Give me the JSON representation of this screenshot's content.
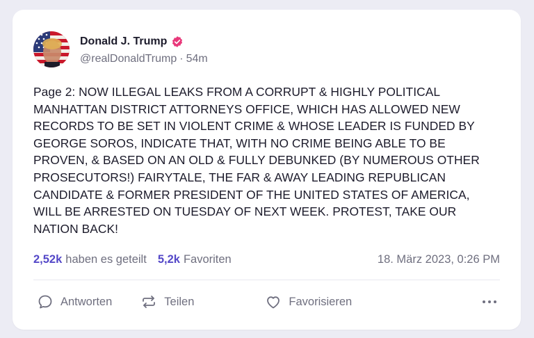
{
  "post": {
    "author": {
      "display_name": "Donald J. Trump",
      "handle": "@realDonaldTrump",
      "separator": "·",
      "age": "54m",
      "verified_icon": "verified-badge-icon",
      "verified_color": "#e8387a"
    },
    "text": "Page 2: NOW ILLEGAL LEAKS FROM A CORRUPT & HIGHLY POLITICAL MANHATTAN DISTRICT ATTORNEYS OFFICE, WHICH HAS ALLOWED NEW RECORDS TO BE SET IN VIOLENT CRIME & WHOSE LEADER IS FUNDED BY GEORGE SOROS, INDICATE THAT, WITH NO CRIME BEING ABLE TO BE PROVEN, & BASED ON AN OLD & FULLY DEBUNKED (BY NUMEROUS OTHER PROSECUTORS!) FAIRYTALE, THE FAR & AWAY LEADING REPUBLICAN CANDIDATE & FORMER PRESIDENT OF THE UNITED STATES OF AMERICA, WILL BE ARRESTED ON TUESDAY OF NEXT WEEK. PROTEST, TAKE OUR NATION BACK!",
    "stats": {
      "shares_count": "2,52k",
      "shares_label": "haben es geteilt",
      "favorites_count": "5,2k",
      "favorites_label": "Favoriten",
      "count_color": "#5448c8"
    },
    "timestamp": "18. März 2023, 0:26 PM"
  },
  "actions": {
    "reply": {
      "label": "Antworten",
      "icon": "reply-bubble-icon"
    },
    "share": {
      "label": "Teilen",
      "icon": "repost-arrows-icon"
    },
    "favorite": {
      "label": "Favorisieren",
      "icon": "heart-icon"
    },
    "more": {
      "icon": "more-dots-icon"
    }
  },
  "colors": {
    "page_background": "#ececf4",
    "card_background": "#ffffff",
    "text_primary": "#1c1b2b",
    "text_secondary": "#6f6f7f"
  }
}
